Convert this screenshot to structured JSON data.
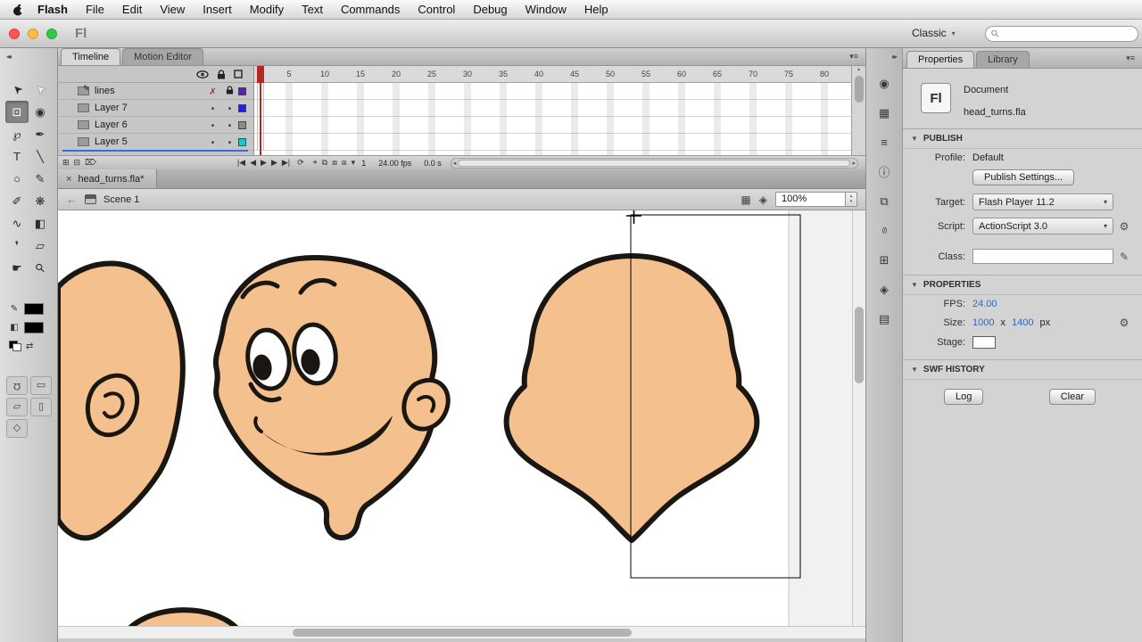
{
  "window": {
    "app_label": "Fl"
  },
  "menubar": {
    "items": [
      "Flash",
      "File",
      "Edit",
      "View",
      "Insert",
      "Modify",
      "Text",
      "Commands",
      "Control",
      "Debug",
      "Window",
      "Help"
    ]
  },
  "titlebar": {
    "workspace": "Classic"
  },
  "icons": {
    "panel_menu": "▾≡",
    "collapse_left": "◂◂",
    "collapse_right": "▸▸",
    "back_arrow": "←",
    "close": "×",
    "dropdown_arrow": "▾",
    "section_triangle": "▼",
    "search": "⚲",
    "stepper_up": "▴",
    "stepper_down": "▾",
    "stroke_pencil": "✎",
    "fill_bucket": "◧",
    "swap_colors": "⇄",
    "wrench": "⚙",
    "class_pencil": "✎",
    "scroll_left": "◂",
    "scroll_right": "▸",
    "scroll_up": "▴",
    "scroll_down": "▾"
  },
  "toolbar": {
    "tools": [
      {
        "name": "selection-tool",
        "glyph": "➤",
        "rot": -135
      },
      {
        "name": "subselection-tool",
        "glyph": "➤",
        "rot": -135,
        "hollow": true
      },
      {
        "name": "free-transform-tool",
        "glyph": "⊡",
        "active": true
      },
      {
        "name": "3d-rotation-tool",
        "glyph": "◉"
      },
      {
        "name": "lasso-tool",
        "glyph": "℘"
      },
      {
        "name": "pen-tool",
        "glyph": "✒"
      },
      {
        "name": "text-tool",
        "glyph": "T"
      },
      {
        "name": "line-tool",
        "glyph": "╲"
      },
      {
        "name": "oval-tool",
        "glyph": "○"
      },
      {
        "name": "pencil-tool",
        "glyph": "✎"
      },
      {
        "name": "brush-tool",
        "glyph": "✐"
      },
      {
        "name": "deco-tool",
        "glyph": "❋"
      },
      {
        "name": "bone-tool",
        "glyph": "∿"
      },
      {
        "name": "paint-bucket-tool",
        "glyph": "◧"
      },
      {
        "name": "eyedropper-tool",
        "glyph": "❜"
      },
      {
        "name": "eraser-tool",
        "glyph": "▱"
      },
      {
        "name": "hand-tool",
        "glyph": "☛"
      },
      {
        "name": "zoom-tool",
        "glyph": "⚲",
        "rot": -45
      }
    ],
    "options": [
      {
        "name": "snap-to-objects-option",
        "glyph": "Ω",
        "rot": 180
      },
      {
        "name": "scale-option",
        "glyph": "▭"
      },
      {
        "name": "rotate-skew-option",
        "glyph": "▱"
      },
      {
        "name": "distort-option",
        "glyph": "▯"
      },
      {
        "name": "envelope-option",
        "glyph": "◇"
      }
    ]
  },
  "timeline": {
    "tabs": [
      {
        "label": "Timeline"
      },
      {
        "label": "Motion Editor"
      }
    ],
    "layers": [
      {
        "name": "lines",
        "hidden": true,
        "locked": true,
        "active": true,
        "color": "#5b21b6"
      },
      {
        "name": "Layer 7",
        "hidden": false,
        "locked": false,
        "active": false,
        "color": "#2323d6"
      },
      {
        "name": "Layer 6",
        "hidden": false,
        "locked": false,
        "active": false,
        "color": "#8a8a8a"
      },
      {
        "name": "Layer 5",
        "hidden": false,
        "locked": false,
        "active": false,
        "color": "#18c7c7"
      }
    ],
    "ruler": [
      5,
      10,
      15,
      20,
      25,
      30,
      35,
      40,
      45,
      50,
      55,
      60,
      65,
      70,
      75,
      80
    ],
    "layer_ops": [
      {
        "name": "new-layer-button",
        "glyph": "⊞"
      },
      {
        "name": "new-folder-button",
        "glyph": "⊟"
      },
      {
        "name": "delete-layer-button",
        "glyph": "⌦"
      }
    ],
    "playback": [
      {
        "name": "go-to-first-frame-button",
        "glyph": "|◀"
      },
      {
        "name": "step-back-button",
        "glyph": "◀"
      },
      {
        "name": "play-button",
        "glyph": "▶"
      },
      {
        "name": "step-forward-button",
        "glyph": "▶"
      },
      {
        "name": "go-to-last-frame-button",
        "glyph": "▶|"
      }
    ],
    "loop_glyph": "⟳",
    "onion": [
      {
        "name": "center-frame-button",
        "glyph": "⌖"
      },
      {
        "name": "onion-skin-button",
        "glyph": "⧉"
      },
      {
        "name": "onion-skin-outlines-button",
        "glyph": "⧇"
      },
      {
        "name": "edit-multiple-frames-button",
        "glyph": "⧈"
      },
      {
        "name": "modify-markers-button",
        "glyph": "▾"
      }
    ],
    "status": {
      "current_frame": "1",
      "frame_rate": "24.00 fps",
      "elapsed_time": "0.0 s"
    }
  },
  "document": {
    "tab_title": "head_turns.fla*",
    "scene": "Scene 1",
    "zoom": "100%",
    "edit_scene_glyph": "▦",
    "edit_symbol_glyph": "◈"
  },
  "dock": {
    "panels": [
      {
        "name": "color-panel-icon",
        "glyph": "◉"
      },
      {
        "name": "swatches-panel-icon",
        "glyph": "▦"
      },
      {
        "name": "align-panel-icon",
        "glyph": "≡"
      },
      {
        "name": "info-panel-icon",
        "glyph": "ⓘ"
      },
      {
        "name": "transform-panel-icon",
        "glyph": "⧉"
      },
      {
        "name": "code-snippets-panel-icon",
        "glyph": "⟨/⟩",
        "small": true
      },
      {
        "name": "components-panel-icon",
        "glyph": "⊞"
      },
      {
        "name": "motion-presets-panel-icon",
        "glyph": "◈"
      },
      {
        "name": "project-panel-icon",
        "glyph": "▤"
      }
    ]
  },
  "properties": {
    "tabs": [
      {
        "label": "Properties"
      },
      {
        "label": "Library"
      }
    ],
    "logo": "Fl",
    "doc_type": "Document",
    "doc_name": "head_turns.fla",
    "publish": {
      "section": "PUBLISH",
      "profile_label": "Profile:",
      "profile_value": "Default",
      "publish_settings_button": "Publish Settings...",
      "target_label": "Target:",
      "target_value": "Flash Player 11.2",
      "script_label": "Script:",
      "script_value": "ActionScript 3.0",
      "class_label": "Class:",
      "class_value": ""
    },
    "props": {
      "section": "PROPERTIES",
      "fps_label": "FPS:",
      "fps_value": "24.00",
      "size_label": "Size:",
      "size_width": "1000",
      "size_times": "x",
      "size_height": "1400",
      "size_unit": "px",
      "stage_label": "Stage:"
    },
    "history": {
      "section": "SWF HISTORY",
      "log_button": "Log",
      "clear_button": "Clear"
    }
  },
  "colors": {
    "skin": "#f4c08d",
    "ink": "#1a1612",
    "value_blue": "#2e66c4",
    "playhead_red": "#b62625",
    "stage": "#ffffff"
  }
}
